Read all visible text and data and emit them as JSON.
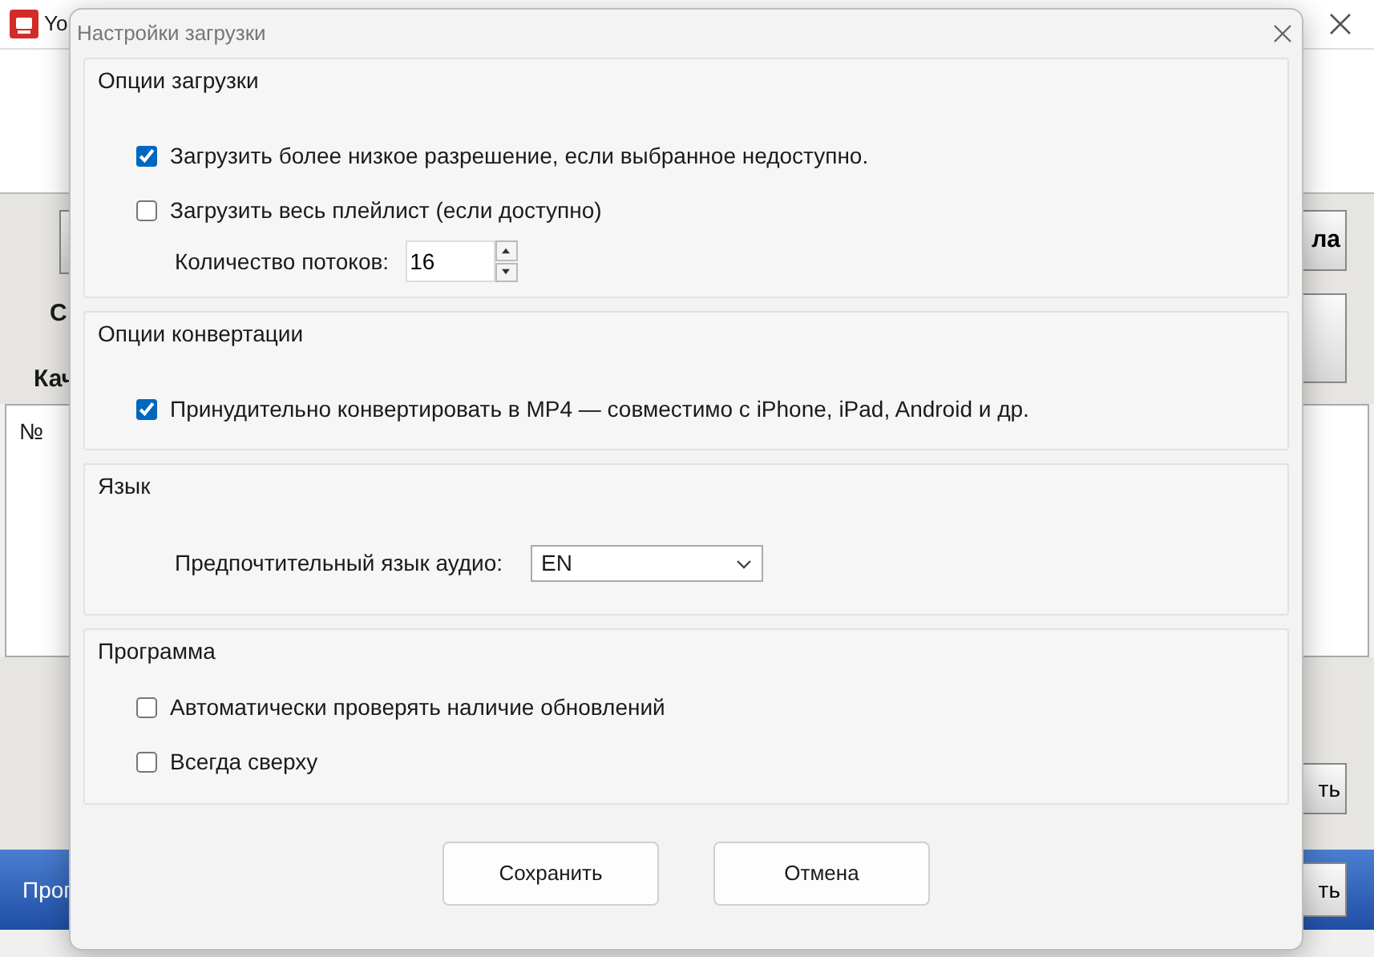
{
  "background_window": {
    "title": "Yo",
    "left_labels": [
      "С",
      "Кач"
    ],
    "top_right_button": "ла",
    "table_header": "№",
    "lower_right_button": "ть",
    "bottom_left_button": "Прог",
    "bottom_right_button": "ть"
  },
  "dialog": {
    "title": "Настройки загрузки",
    "groups": [
      {
        "title": "Опции загрузки",
        "items": [
          {
            "kind": "checkbox",
            "label": "Загрузить более низкое разрешение, если выбранное недоступно.",
            "checked": true
          },
          {
            "kind": "checkbox",
            "label": "Загрузить весь плейлист (если доступно)",
            "checked": false
          },
          {
            "kind": "spinner",
            "label": "Количество потоков:",
            "value": "16"
          }
        ]
      },
      {
        "title": "Опции конвертации",
        "items": [
          {
            "kind": "checkbox",
            "label": "Принудительно конвертировать в MP4 — совместимо с iPhone, iPad, Android и др.",
            "checked": true
          }
        ]
      },
      {
        "title": "Язык",
        "items": [
          {
            "kind": "select",
            "label": "Предпочтительный язык аудио:",
            "value": "EN"
          }
        ]
      },
      {
        "title": "Программа",
        "items": [
          {
            "kind": "checkbox",
            "label": "Автоматически проверять наличие обновлений",
            "checked": false
          },
          {
            "kind": "checkbox",
            "label": "Всегда сверху",
            "checked": false
          }
        ]
      }
    ],
    "buttons": [
      "Сохранить",
      "Отмена"
    ]
  }
}
